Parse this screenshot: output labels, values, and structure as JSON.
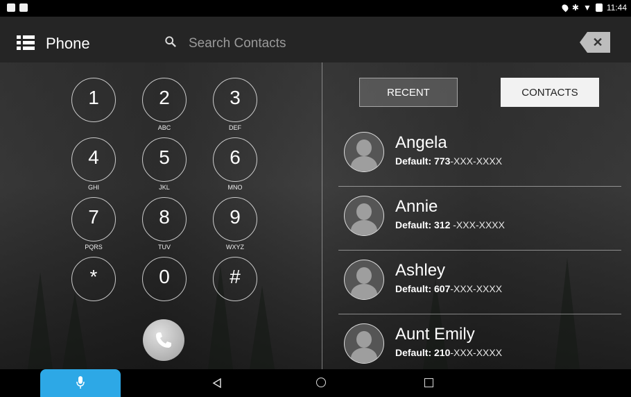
{
  "status_bar": {
    "time": "11:44"
  },
  "app_bar": {
    "title": "Phone",
    "search": {
      "placeholder": "Search Contacts",
      "value": ""
    },
    "clear_icon": "close-icon"
  },
  "dialpad": {
    "keys": [
      {
        "digit": "1",
        "letters": ""
      },
      {
        "digit": "2",
        "letters": "ABC"
      },
      {
        "digit": "3",
        "letters": "DEF"
      },
      {
        "digit": "4",
        "letters": "GHI"
      },
      {
        "digit": "5",
        "letters": "JKL"
      },
      {
        "digit": "6",
        "letters": "MNO"
      },
      {
        "digit": "7",
        "letters": "PQRS"
      },
      {
        "digit": "8",
        "letters": "TUV"
      },
      {
        "digit": "9",
        "letters": "WXYZ"
      },
      {
        "digit": "*",
        "letters": ""
      },
      {
        "digit": "0",
        "letters": ""
      },
      {
        "digit": "#",
        "letters": ""
      }
    ],
    "call_icon": "phone-icon"
  },
  "tabs": {
    "recent": "RECENT",
    "contacts": "CONTACTS",
    "selected": "contacts"
  },
  "contacts": [
    {
      "name": "Angela",
      "label": "Default:",
      "number": "773",
      "masked": "-XXX-XXXX"
    },
    {
      "name": "Annie",
      "label": "Default:",
      "number": "312",
      "masked": "-XXX-XXXX"
    },
    {
      "name": "Ashley",
      "label": "Default:",
      "number": "607",
      "masked": "-XXX-XXXX"
    },
    {
      "name": "Aunt Emily",
      "label": "Default:",
      "number": "210",
      "masked": "-XXX-XXXX"
    }
  ],
  "nav_bar": {
    "mic_icon": "microphone-icon",
    "back_icon": "back-icon",
    "home_icon": "home-icon",
    "recents_icon": "recents-icon"
  },
  "colors": {
    "accent": "#2da8e6",
    "app_bar": "#282828"
  }
}
